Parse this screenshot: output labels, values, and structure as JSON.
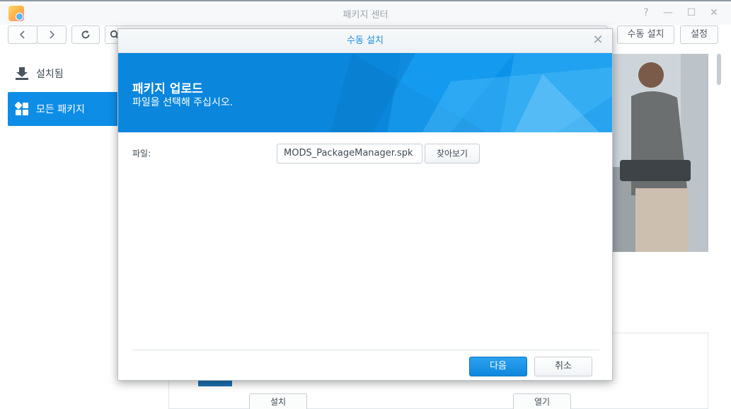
{
  "window": {
    "title": "패키지 센터",
    "help_glyph": "?",
    "minimize_glyph": "—",
    "maximize_glyph": "☐",
    "close_glyph": "✕"
  },
  "toolbar": {
    "back_icon": "chevron-left-icon",
    "forward_icon": "chevron-right-icon",
    "refresh_icon": "refresh-icon",
    "search_icon": "search-icon",
    "manual_install_label": "수동 설치",
    "settings_label": "설정"
  },
  "sidebar": {
    "items": [
      {
        "label": "설치됨",
        "icon": "download-icon",
        "active": false
      },
      {
        "label": "모든 패키지",
        "icon": "grid-icon",
        "active": true
      }
    ]
  },
  "background": {
    "install_label": "설치",
    "open_label": "열기"
  },
  "dialog": {
    "title": "수동 설치",
    "close_glyph": "✕",
    "banner_title": "패키지 업로드",
    "banner_subtitle": "파일을 선택해 주십시오.",
    "file_label": "파일:",
    "file_value": "MODS_PackageManager.spk",
    "browse_label": "찾아보기",
    "next_label": "다음",
    "cancel_label": "취소"
  },
  "colors": {
    "accent": "#0e8de6",
    "banner": "#0a86dc",
    "dialog_title": "#1e8fe0"
  }
}
